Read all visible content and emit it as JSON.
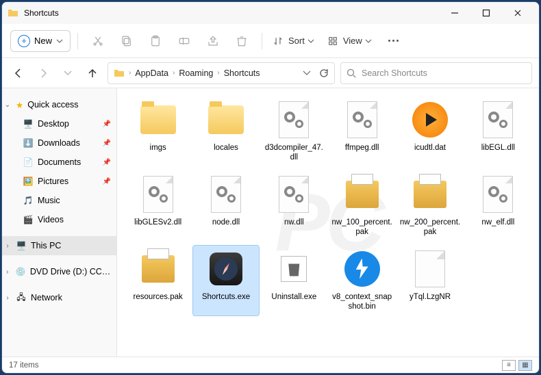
{
  "window": {
    "title": "Shortcuts",
    "item_count": "17 items"
  },
  "toolbar": {
    "new_label": "New",
    "sort_label": "Sort",
    "view_label": "View"
  },
  "breadcrumbs": [
    "AppData",
    "Roaming",
    "Shortcuts"
  ],
  "search": {
    "placeholder": "Search Shortcuts"
  },
  "sidebar": {
    "quick_access": "Quick access",
    "items": [
      {
        "label": "Desktop",
        "pin": true
      },
      {
        "label": "Downloads",
        "pin": true
      },
      {
        "label": "Documents",
        "pin": true
      },
      {
        "label": "Pictures",
        "pin": true
      },
      {
        "label": "Music"
      },
      {
        "label": "Videos"
      }
    ],
    "this_pc": "This PC",
    "dvd": "DVD Drive (D:) CCCC",
    "network": "Network"
  },
  "files": [
    {
      "name": "imgs",
      "type": "folder"
    },
    {
      "name": "locales",
      "type": "folder"
    },
    {
      "name": "d3dcompiler_47.dll",
      "type": "dll"
    },
    {
      "name": "ffmpeg.dll",
      "type": "dll"
    },
    {
      "name": "icudtl.dat",
      "type": "dat"
    },
    {
      "name": "libEGL.dll",
      "type": "dll"
    },
    {
      "name": "libGLESv2.dll",
      "type": "dll"
    },
    {
      "name": "node.dll",
      "type": "dll"
    },
    {
      "name": "nw.dll",
      "type": "dll"
    },
    {
      "name": "nw_100_percent.pak",
      "type": "pak"
    },
    {
      "name": "nw_200_percent.pak",
      "type": "pak"
    },
    {
      "name": "nw_elf.dll",
      "type": "dll"
    },
    {
      "name": "resources.pak",
      "type": "pak"
    },
    {
      "name": "Shortcuts.exe",
      "type": "shortcuts",
      "selected": true
    },
    {
      "name": "Uninstall.exe",
      "type": "uninstall"
    },
    {
      "name": "v8_context_snapshot.bin",
      "type": "bin"
    },
    {
      "name": "yTql.LzgNR",
      "type": "blank"
    }
  ]
}
